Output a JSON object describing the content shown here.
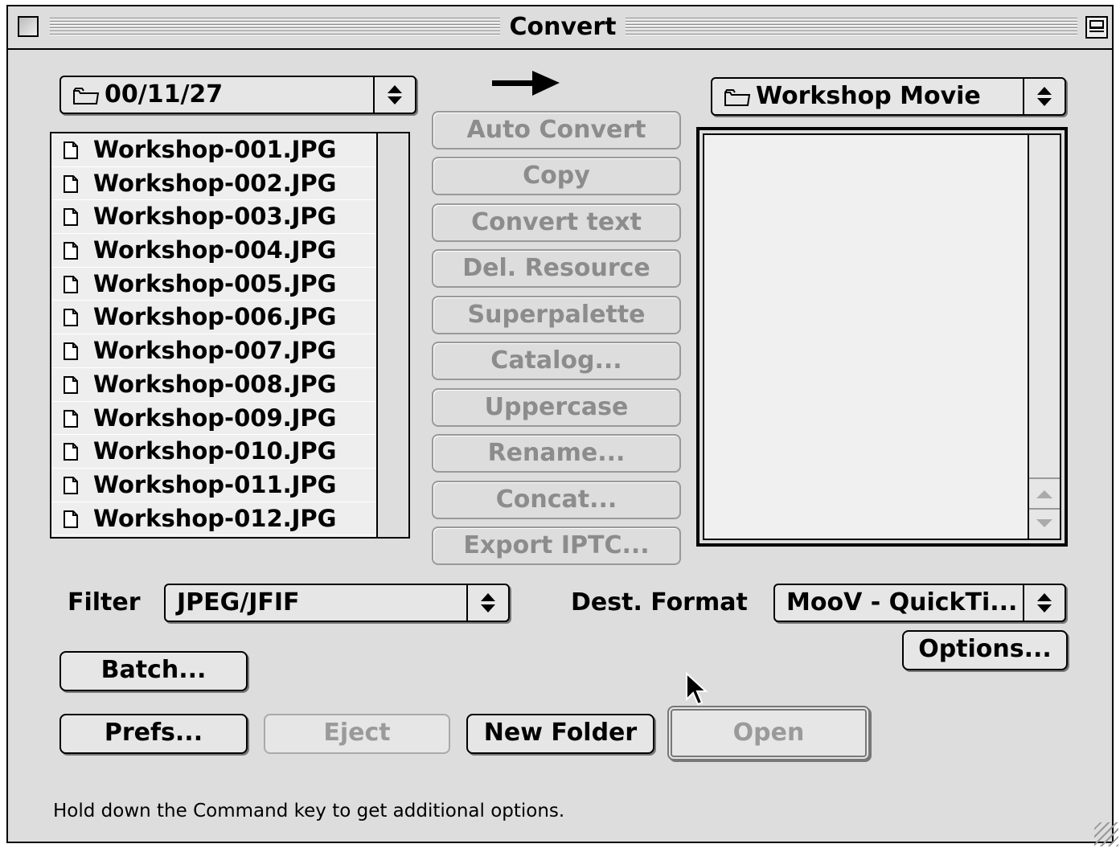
{
  "window": {
    "title": "Convert"
  },
  "source": {
    "folder": "00/11/27",
    "files": [
      "Workshop-001.JPG",
      "Workshop-002.JPG",
      "Workshop-003.JPG",
      "Workshop-004.JPG",
      "Workshop-005.JPG",
      "Workshop-006.JPG",
      "Workshop-007.JPG",
      "Workshop-008.JPG",
      "Workshop-009.JPG",
      "Workshop-010.JPG",
      "Workshop-011.JPG",
      "Workshop-012.JPG"
    ]
  },
  "dest": {
    "folder": "Workshop Movie"
  },
  "actions": [
    "Auto Convert",
    "Copy",
    "Convert text",
    "Del. Resource",
    "Superpalette",
    "Catalog...",
    "Uppercase",
    "Rename...",
    "Concat...",
    "Export IPTC..."
  ],
  "filter": {
    "label": "Filter",
    "value": "JPEG/JFIF"
  },
  "dest_format": {
    "label": "Dest. Format",
    "value": "MooV - QuickTi..."
  },
  "buttons": {
    "options": "Options...",
    "batch": "Batch...",
    "prefs": "Prefs...",
    "eject": "Eject",
    "new_folder": "New Folder",
    "open": "Open"
  },
  "status": "Hold down the Command key to get additional options.",
  "icons": {
    "folder": "folder-icon",
    "document": "document-icon",
    "arrow": "right-arrow-icon"
  }
}
